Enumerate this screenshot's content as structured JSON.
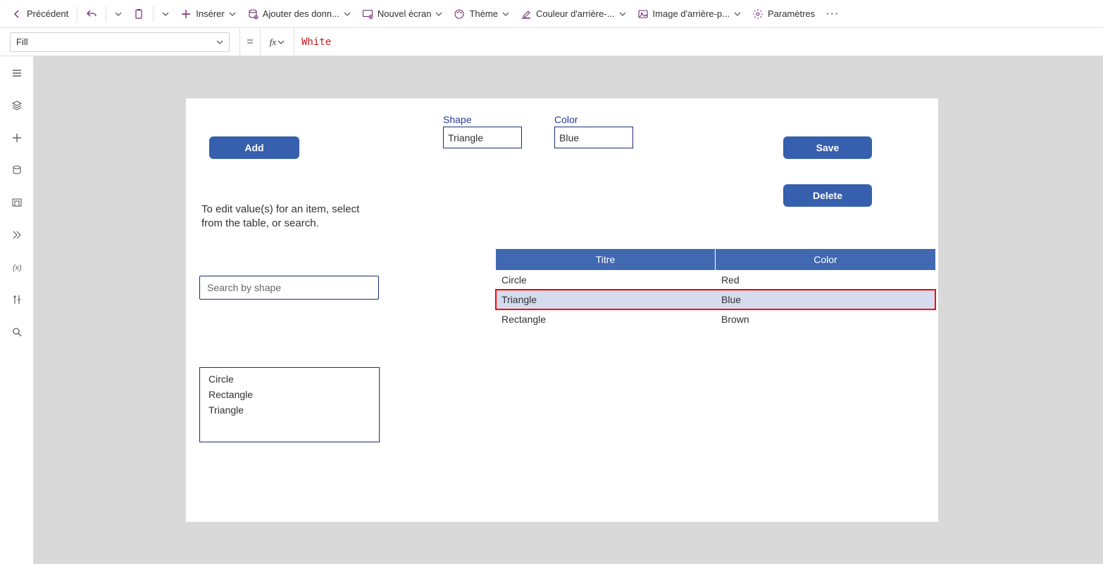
{
  "toolbar": {
    "back": "Précédent",
    "insert": "Insérer",
    "add_data": "Ajouter des donn...",
    "new_screen": "Nouvel écran",
    "theme": "Thème",
    "bg_color": "Couleur d'arrière-...",
    "bg_image": "Image d'arrière-p...",
    "settings": "Paramètres"
  },
  "formula": {
    "property": "Fill",
    "equals": "=",
    "fx": "fx",
    "value": "White"
  },
  "form": {
    "add_label": "Add",
    "save_label": "Save",
    "delete_label": "Delete",
    "shape_label": "Shape",
    "shape_value": "Triangle",
    "color_label": "Color",
    "color_value": "Blue",
    "helper": "To edit value(s) for an item, select from the table, or search.",
    "search_placeholder": "Search by shape"
  },
  "list": [
    "Circle",
    "Rectangle",
    "Triangle"
  ],
  "grid": {
    "headers": [
      "Titre",
      "Color"
    ],
    "rows": [
      {
        "title": "Circle",
        "color": "Red",
        "selected": false
      },
      {
        "title": "Triangle",
        "color": "Blue",
        "selected": true
      },
      {
        "title": "Rectangle",
        "color": "Brown",
        "selected": false
      }
    ]
  }
}
